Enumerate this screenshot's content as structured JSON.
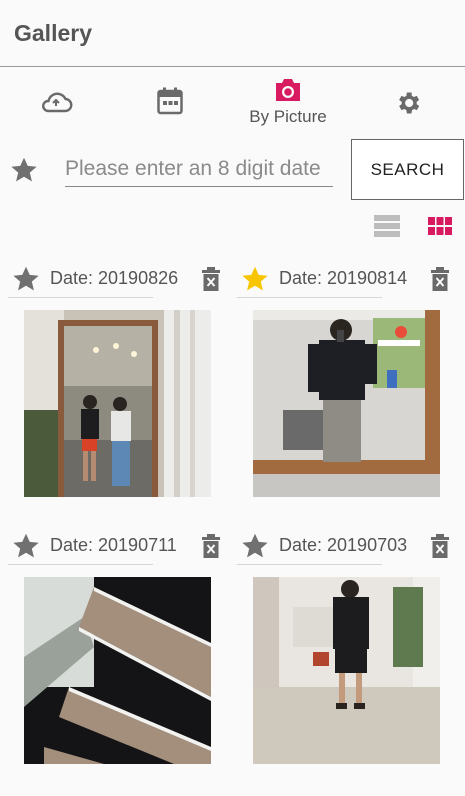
{
  "app": {
    "title": "Gallery"
  },
  "tabs": [
    {
      "icon": "cloud-sync-icon",
      "label": ""
    },
    {
      "icon": "calendar-icon",
      "label": ""
    },
    {
      "icon": "camera-icon",
      "label": "By Picture",
      "active": true
    },
    {
      "icon": "gear-icon",
      "label": ""
    }
  ],
  "search": {
    "placeholder": "Please enter an 8 digit date",
    "button_label": "SEARCH"
  },
  "view_toggle": {
    "list_icon": "list-view-icon",
    "grid_icon": "grid-view-icon",
    "active": "grid"
  },
  "colors": {
    "accent": "#d81b60",
    "star_active": "#f7c600",
    "star_inactive": "#707070"
  },
  "photos": [
    {
      "date_label": "Date: 20190826",
      "starred": false,
      "photo": "mirror selfie of two people in a room with hanging lights"
    },
    {
      "date_label": "Date: 20190814",
      "starred": true,
      "photo": "mirror selfie, black shirt and gray pants"
    },
    {
      "date_label": "Date: 20190711",
      "starred": false,
      "photo": "close-up of black and beige striped knit shirt"
    },
    {
      "date_label": "Date: 20190703",
      "starred": false,
      "photo": "full-length mirror selfie, black outfit"
    }
  ]
}
